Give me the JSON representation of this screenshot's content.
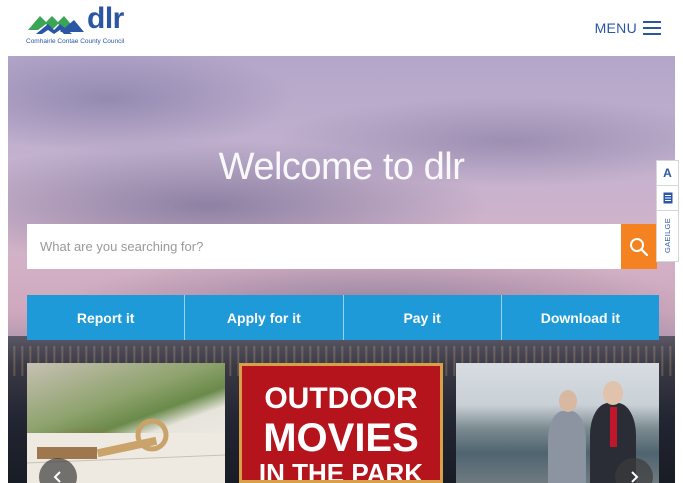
{
  "header": {
    "logo_text": "dlr",
    "logo_subtitle": "Comhairle Contae County Council",
    "menu_label": "MENU"
  },
  "hero": {
    "title": "Welcome to dlr"
  },
  "search": {
    "placeholder": "What are you searching for?",
    "button_icon": "search-icon"
  },
  "actions": [
    {
      "label": "Report it"
    },
    {
      "label": "Apply for it"
    },
    {
      "label": "Pay it"
    },
    {
      "label": "Download it"
    }
  ],
  "side_tools": {
    "text_size": "A",
    "document_icon": "document-icon",
    "language": "GAEILGE"
  },
  "cards": [
    {
      "image": "house-keys-on-document"
    },
    {
      "line1": "OUTDOOR",
      "line2": "MOVIES",
      "line3": "IN THE PARK"
    },
    {
      "image": "two-people-at-harbour"
    }
  ],
  "colors": {
    "brand_blue": "#2b56a5",
    "action_blue": "#1e9ad8",
    "search_orange": "#f58220",
    "logo_green": "#3aa655"
  }
}
